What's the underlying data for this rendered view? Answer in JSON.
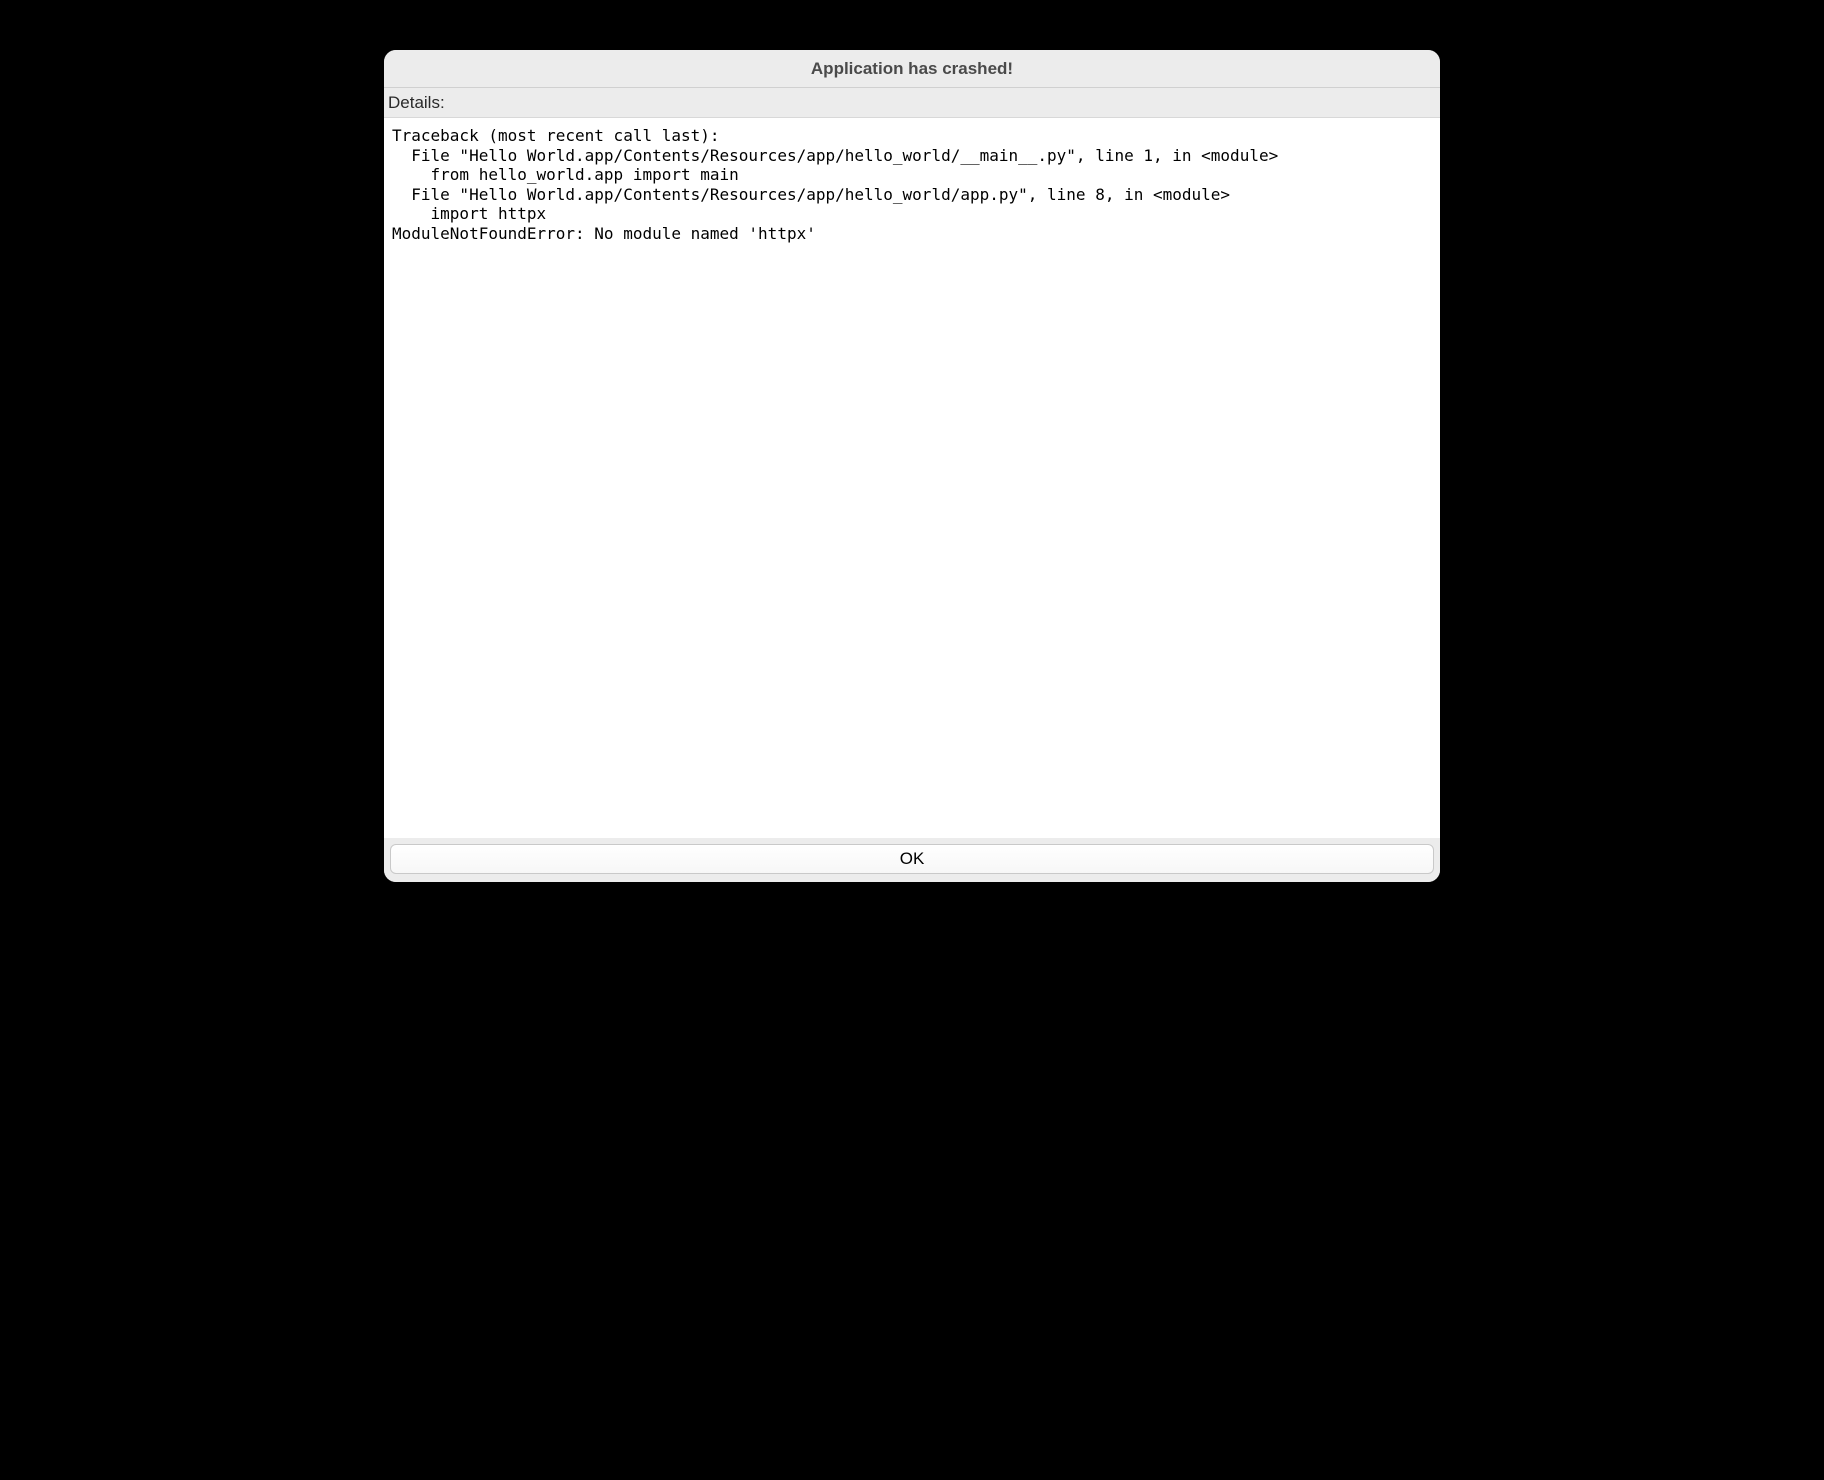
{
  "dialog": {
    "title": "Application has crashed!",
    "details_label": "Details:",
    "traceback": "Traceback (most recent call last):\n  File \"Hello World.app/Contents/Resources/app/hello_world/__main__.py\", line 1, in <module>\n    from hello_world.app import main\n  File \"Hello World.app/Contents/Resources/app/hello_world/app.py\", line 8, in <module>\n    import httpx\nModuleNotFoundError: No module named 'httpx'",
    "ok_label": "OK"
  }
}
